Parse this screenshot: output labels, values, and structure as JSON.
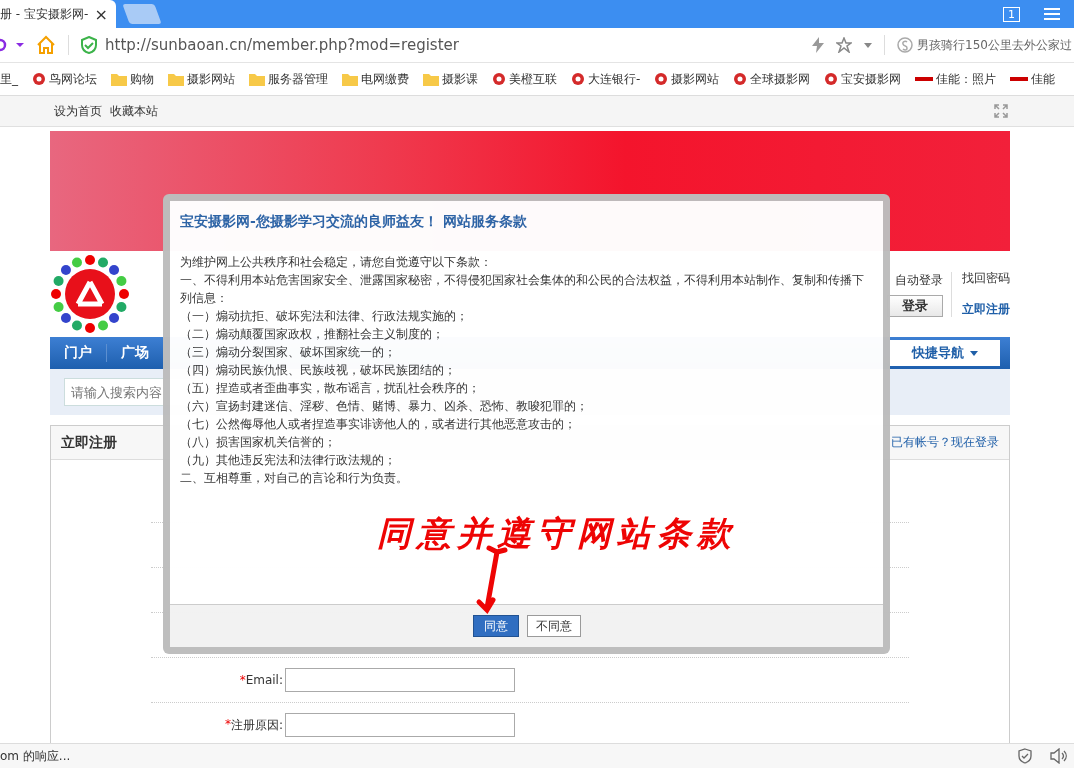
{
  "browser": {
    "tab": {
      "title": "册 - 宝安摄影网-",
      "close": "×"
    },
    "tab_count": "1",
    "url": "http://sunbaoan.cn/member.php?mod=register",
    "search_hint": "男孩骑行150公里去外公家过",
    "bookmarks": [
      {
        "label": "里_",
        "kind": "text"
      },
      {
        "label": "鸟网论坛",
        "kind": "site"
      },
      {
        "label": "购物",
        "kind": "folder"
      },
      {
        "label": "摄影网站",
        "kind": "folder"
      },
      {
        "label": "服务器管理",
        "kind": "folder"
      },
      {
        "label": "电网缴费",
        "kind": "folder"
      },
      {
        "label": "摄影课",
        "kind": "folder"
      },
      {
        "label": "美橙互联",
        "kind": "site"
      },
      {
        "label": "大连银行-",
        "kind": "site"
      },
      {
        "label": "摄影网站",
        "kind": "site"
      },
      {
        "label": "全球摄影网",
        "kind": "site"
      },
      {
        "label": "宝安摄影网",
        "kind": "site"
      },
      {
        "label": "佳能：照片",
        "kind": "canon"
      },
      {
        "label": "佳能",
        "kind": "canon"
      }
    ]
  },
  "site_topbar": {
    "links": [
      "设为首页",
      "收藏本站"
    ]
  },
  "header": {
    "auto_login": "自动登录",
    "find_password": "找回密码",
    "login_button": "登录",
    "register_link": "立即注册"
  },
  "nav": {
    "items": [
      "门户",
      "广场"
    ],
    "quick_nav": "快捷导航"
  },
  "search": {
    "placeholder": "请输入搜索内容"
  },
  "register": {
    "title": "立即注册",
    "login_link": "已有帐号？现在登录",
    "fields": [
      {
        "label": "Email:",
        "required": true,
        "marker": "*"
      },
      {
        "label": "注册原因:",
        "required": true,
        "marker": "*"
      }
    ]
  },
  "modal": {
    "title": "宝安摄影网-您摄影学习交流的良师益友！ 网站服务条款",
    "lines": [
      "为维护网上公共秩序和社会稳定，请您自觉遵守以下条款：",
      "一、不得利用本站危害国家安全、泄露国家秘密，不得侵犯国家社会集体的和公民的合法权益，不得利用本站制作、复制和传播下列信息：",
      "（一）煽动抗拒、破坏宪法和法律、行政法规实施的；",
      "（二）煽动颠覆国家政权，推翻社会主义制度的；",
      "（三）煽动分裂国家、破坏国家统一的；",
      "（四）煽动民族仇恨、民族歧视，破坏民族团结的；",
      "（五）捏造或者歪曲事实，散布谣言，扰乱社会秩序的；",
      "（六）宣扬封建迷信、淫秽、色情、赌博、暴力、凶杀、恐怖、教唆犯罪的；",
      "（七）公然侮辱他人或者捏造事实诽谤他人的，或者进行其他恶意攻击的；",
      "（八）损害国家机关信誉的；",
      "（九）其他违反宪法和法律行政法规的；",
      "二、互相尊重，对自己的言论和行为负责。"
    ],
    "annotation": "同意并遵守网站条款",
    "buttons": [
      {
        "label": "同意",
        "primary": true
      },
      {
        "label": "不同意",
        "primary": false
      }
    ]
  },
  "status_bar": {
    "text": "om 的响应..."
  }
}
